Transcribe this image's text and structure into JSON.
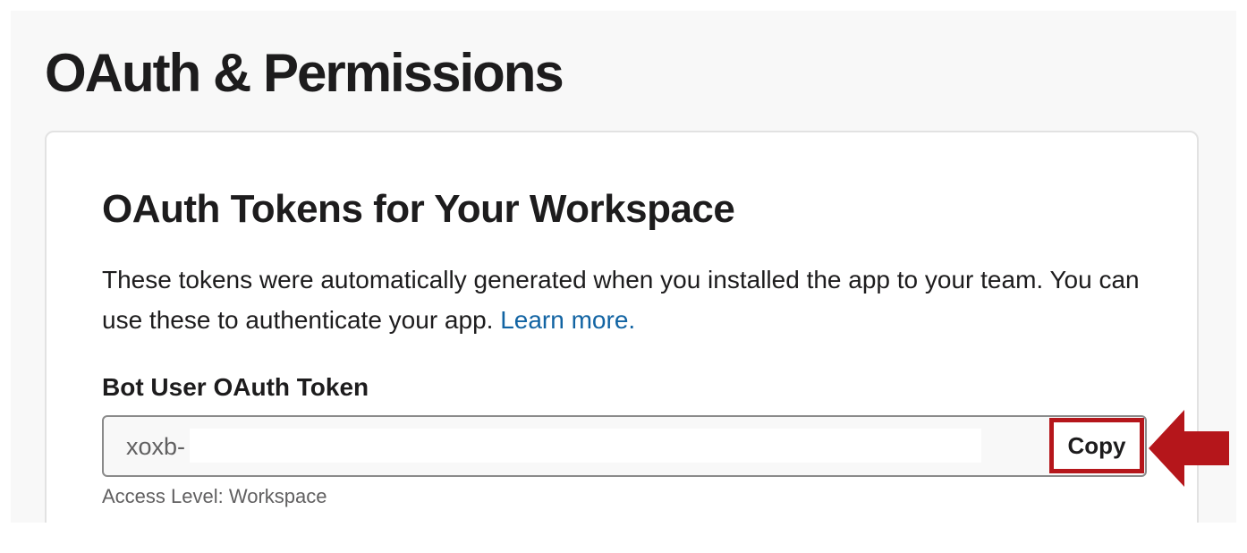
{
  "page": {
    "title": "OAuth & Permissions"
  },
  "card": {
    "title": "OAuth Tokens for Your Workspace",
    "description": "These tokens were automatically generated when you installed the app to your team. You can use these to authenticate your app.",
    "learn_more_label": "Learn more."
  },
  "token_field": {
    "label": "Bot User OAuth Token",
    "value_prefix": "xoxb-",
    "copy_label": "Copy",
    "access_level": "Access Level: Workspace"
  },
  "colors": {
    "link": "#1264a3",
    "highlight": "#b5161b",
    "page_background": "#f8f8f8"
  },
  "icons": {
    "pointer": "arrow-left-icon"
  }
}
